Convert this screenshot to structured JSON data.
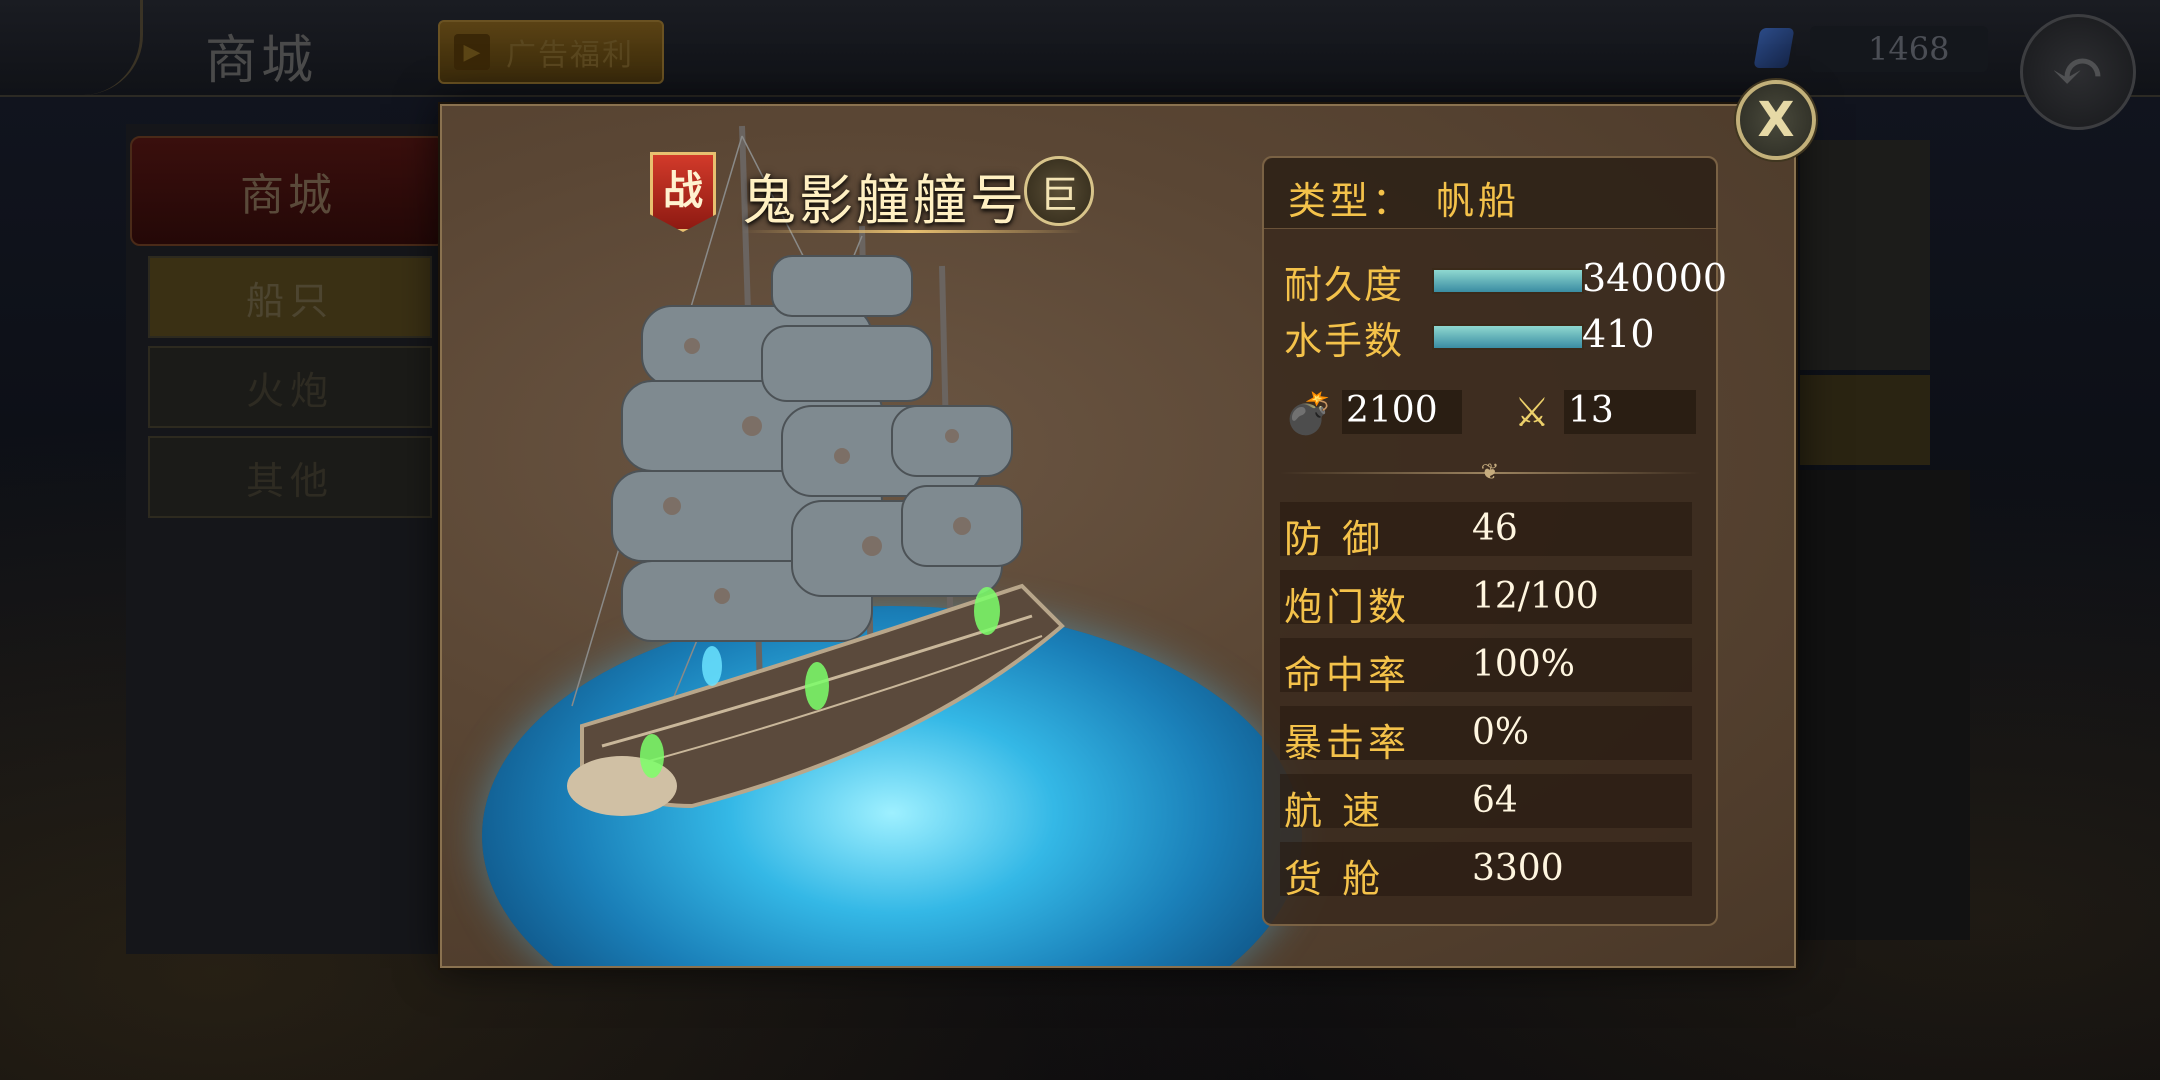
{
  "background": {
    "title": "商城",
    "ad_label": "广告福利",
    "gem_count": "1468",
    "side_header": "商城",
    "tabs": [
      {
        "label": "船只",
        "active": true
      },
      {
        "label": "火炮",
        "active": false
      },
      {
        "label": "其他",
        "active": false
      }
    ]
  },
  "modal": {
    "close_label": "X",
    "war_badge": "战",
    "ship_name": "鬼影艟艟号",
    "size_badge": "巨",
    "type_label": "类型：",
    "type_value": "帆船",
    "durability": {
      "label": "耐久度",
      "value": "340000",
      "fill": 1.0
    },
    "sailors": {
      "label": "水手数",
      "value": "410",
      "fill": 1.0
    },
    "cannon_power": "2100",
    "attack": "13",
    "stats": [
      {
        "label": "防 御",
        "value": "46"
      },
      {
        "label": "炮门数",
        "value": "12/100"
      },
      {
        "label": "命中率",
        "value": "100%"
      },
      {
        "label": "暴击率",
        "value": "0%"
      },
      {
        "label": "航 速",
        "value": "64"
      },
      {
        "label": "货 舱",
        "value": "3300"
      }
    ]
  },
  "icons": {
    "cannon": "cannon-icon",
    "swords": "crossed-swords-icon",
    "close": "close-icon",
    "back": "back-arrow-icon",
    "gem": "gem-icon",
    "play": "play-icon"
  }
}
